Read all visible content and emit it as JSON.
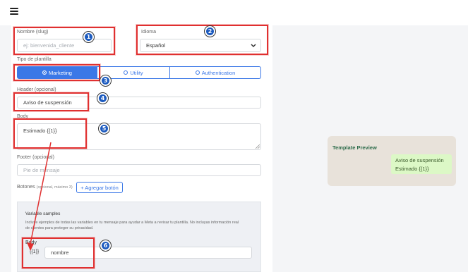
{
  "form": {
    "nombre": {
      "label": "Nombre (slug)",
      "placeholder": "ej: bienvenida_cliente"
    },
    "idioma": {
      "label": "Idioma",
      "value": "Español"
    },
    "tipo": {
      "label": "Tipo de plantilla",
      "options": [
        "Marketing",
        "Utility",
        "Authentication"
      ],
      "selected": "Marketing"
    },
    "header": {
      "label": "Header (opcional)",
      "value": "Aviso de suspensión"
    },
    "body": {
      "label": "Body",
      "value": "Estimado {{1}}"
    },
    "footer": {
      "label": "Footer (opcional)",
      "placeholder": "Pie de mensaje"
    },
    "botones": {
      "label": "Botones",
      "hint": "(opcional, máximo 3)",
      "add_label": "+ Agregar botón"
    },
    "samples": {
      "title": "Variable samples",
      "desc1": "Incluye ejemplos de todas las variables en tu mensaje para ayudar a Meta a revisar tu plantilla. No incluyas información real",
      "desc2": "de clientes para proteger su privacidad.",
      "body_label": "Body",
      "var_name": "{{1}}",
      "var_value": "nombre"
    }
  },
  "preview": {
    "title": "Template Preview",
    "header": "Aviso de suspensión",
    "body": "Estimado {{1}}"
  },
  "annotations": [
    "1",
    "2",
    "3",
    "4",
    "5",
    "6"
  ],
  "colors": {
    "accent": "#3b78e7",
    "highlight": "#e03030",
    "badge": "#1d5bbf",
    "bubble": "#dcf8c6"
  }
}
